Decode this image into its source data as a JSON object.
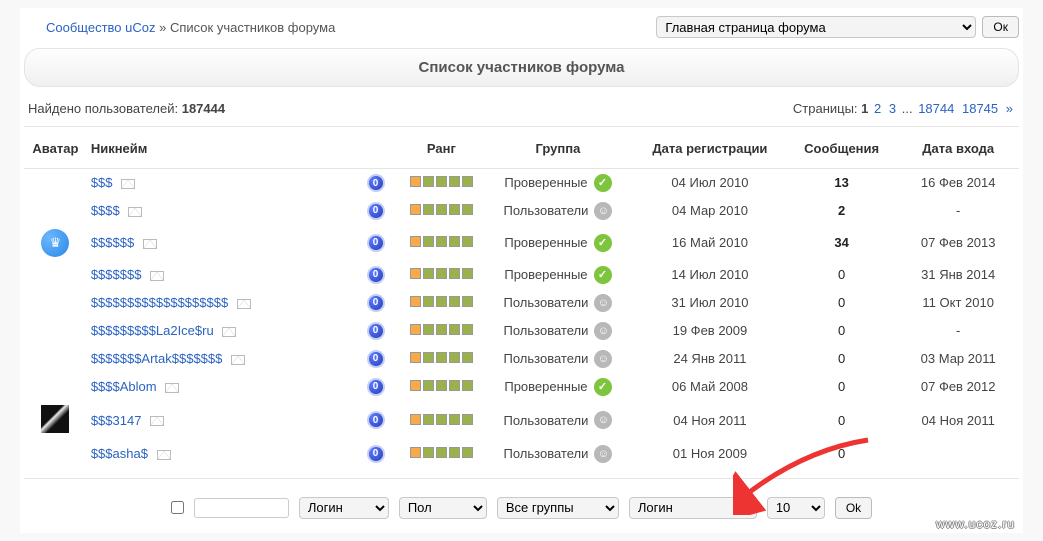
{
  "breadcrumb": {
    "community": "Сообщество uCoz",
    "sep": " » ",
    "current": "Список участников форума"
  },
  "topSelect": "Главная страница форума",
  "okLabel": "Ок",
  "ok2Label": "Ok",
  "heading": "Список участников форума",
  "found_label": "Найдено пользователей: ",
  "found_count": "187444",
  "pages_label": "Страницы: ",
  "pages": [
    "1",
    "2",
    "3",
    "...",
    "18744",
    "18745",
    "»"
  ],
  "columns": {
    "avatar": "Аватар",
    "nick": "Никнейм",
    "rank": "Ранг",
    "group": "Группа",
    "reg": "Дата регистрации",
    "posts": "Сообщения",
    "login": "Дата входа"
  },
  "groups": {
    "verified": "Проверенные",
    "users": "Пользователи"
  },
  "rows": [
    {
      "avatar": "",
      "nick": "$$$",
      "group": "verified",
      "reg": "04 Июл 2010",
      "posts": "13",
      "bold": true,
      "login": "16 Фев 2014"
    },
    {
      "avatar": "",
      "nick": "$$$$",
      "group": "users",
      "reg": "04 Мар 2010",
      "posts": "2",
      "bold": true,
      "login": "-"
    },
    {
      "avatar": "crown",
      "nick": "$$$$$$",
      "group": "verified",
      "reg": "16 Май 2010",
      "posts": "34",
      "bold": true,
      "login": "07 Фев 2013"
    },
    {
      "avatar": "",
      "nick": "$$$$$$$",
      "group": "verified",
      "reg": "14 Июл 2010",
      "posts": "0",
      "bold": false,
      "login": "31 Янв 2014"
    },
    {
      "avatar": "",
      "nick": "$$$$$$$$$$$$$$$$$$$",
      "group": "users",
      "reg": "31 Июл 2010",
      "posts": "0",
      "bold": false,
      "login": "11 Окт 2010"
    },
    {
      "avatar": "",
      "nick": "$$$$$$$$$La2Ice$ru",
      "group": "users",
      "reg": "19 Фев 2009",
      "posts": "0",
      "bold": false,
      "login": "-"
    },
    {
      "avatar": "",
      "nick": "$$$$$$$Artak$$$$$$$",
      "group": "users",
      "reg": "24 Янв 2011",
      "posts": "0",
      "bold": false,
      "login": "03 Мар 2011"
    },
    {
      "avatar": "",
      "nick": "$$$$Ablom",
      "group": "verified",
      "reg": "06 Май 2008",
      "posts": "0",
      "bold": false,
      "login": "07 Фев 2012"
    },
    {
      "avatar": "dark",
      "nick": "$$$3147",
      "group": "users",
      "reg": "04 Ноя 2011",
      "posts": "0",
      "bold": false,
      "login": "04 Ноя 2011"
    },
    {
      "avatar": "",
      "nick": "$$$asha$",
      "group": "users",
      "reg": "01 Ноя 2009",
      "posts": "0",
      "bold": false,
      "login": ""
    }
  ],
  "filters": {
    "login": "Логин",
    "gender": "Пол",
    "groups": "Все группы",
    "sort": "Логин",
    "perpage": "10"
  },
  "watermark": "www.ucoz.ru"
}
